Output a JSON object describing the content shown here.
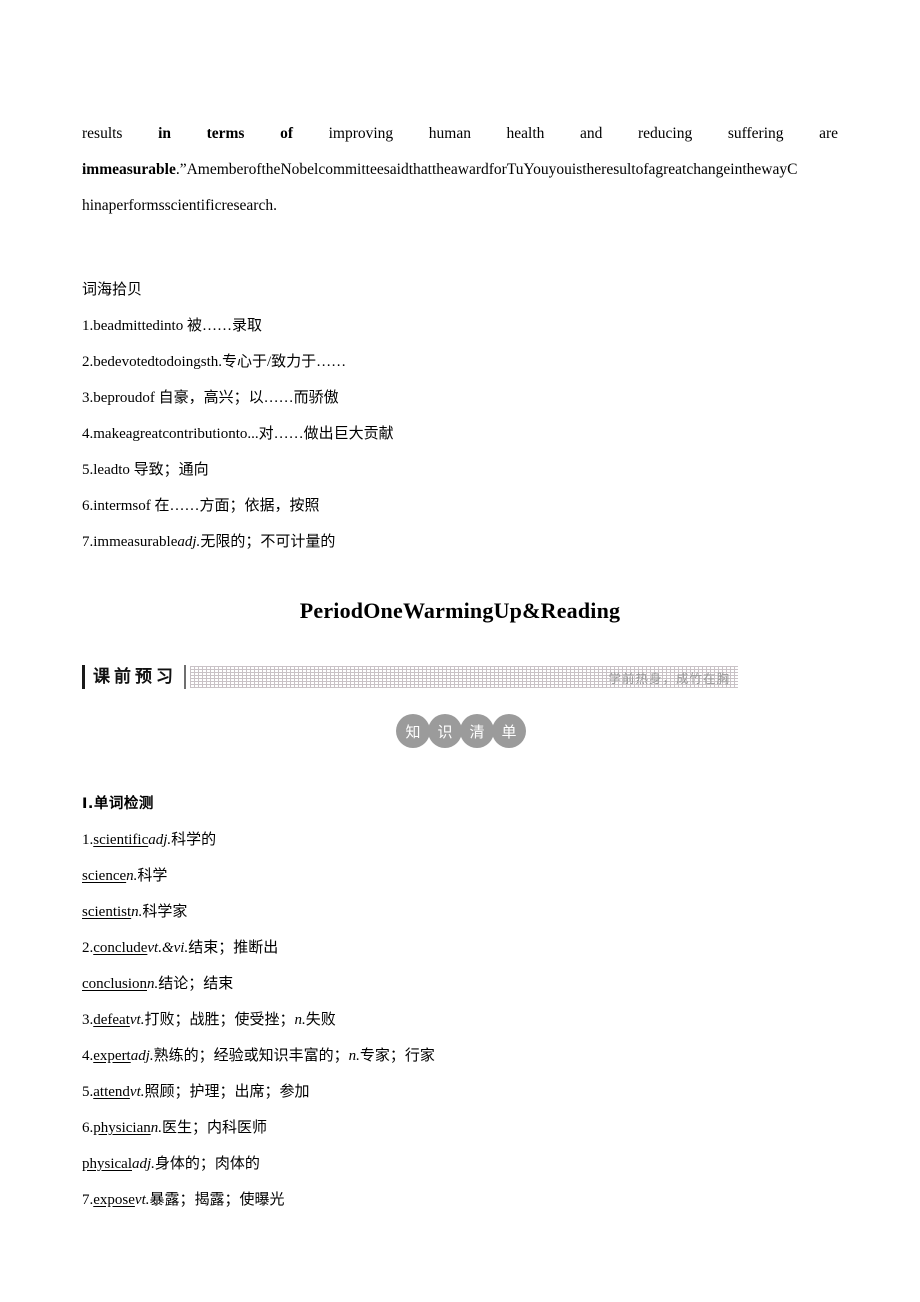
{
  "paragraph": {
    "line1_words": [
      "results",
      "in",
      "terms",
      "of",
      "improving",
      "human",
      "health",
      "and",
      "reducing",
      "suffering",
      "are"
    ],
    "line1_bold": [
      "in",
      "terms",
      "of"
    ],
    "line2_bold": "immeasurable",
    "line2_rest": ".”AmemberoftheNobelcommitteesaidthattheawardforTuYouyouistheresultofagreatchangeinthewayC",
    "line3": "hinaperformsscientificresearch."
  },
  "cihai": {
    "title": "词海拾贝",
    "items": [
      {
        "num": "1.",
        "word": "beadmittedinto",
        "pos": "",
        "gloss": " 被……录取"
      },
      {
        "num": "2.",
        "word": "bedevotedtodoingsth.",
        "pos": "",
        "gloss": "专心于/致力于……"
      },
      {
        "num": "3.",
        "word": "beproudof",
        "pos": "",
        "gloss": " 自豪，高兴；以……而骄傲"
      },
      {
        "num": "4.",
        "word": "makeagreatcontributionto...",
        "pos": "",
        "gloss": "对……做出巨大贡献"
      },
      {
        "num": "5.",
        "word": "leadto",
        "pos": "",
        "gloss": " 导致；通向"
      },
      {
        "num": "6.",
        "word": "intermsof",
        "pos": "",
        "gloss": " 在……方面；依据，按照"
      },
      {
        "num": "7.",
        "word": "immeasurable",
        "pos": "adj.",
        "gloss": "无限的；不可计量的"
      }
    ]
  },
  "period_title": "PeriodOneWarmingUp&Reading",
  "banner": {
    "label": "课前预习",
    "motto": "学前热身，成竹在胸"
  },
  "badge": {
    "chars": [
      "知",
      "识",
      "清",
      "单"
    ]
  },
  "words_section": {
    "heading": "Ⅰ.单词检测",
    "entries": [
      {
        "num": "1.",
        "word": "scientific",
        "pos": "adj.",
        "gloss": "科学的"
      },
      {
        "num": "",
        "word": "science",
        "pos": "n.",
        "gloss": "科学"
      },
      {
        "num": "",
        "word": "scientist",
        "pos": "n.",
        "gloss": "科学家"
      },
      {
        "num": "2.",
        "word": "conclude",
        "pos": "vt.&vi.",
        "gloss": "结束；推断出"
      },
      {
        "num": "",
        "word": "conclusion",
        "pos": "n.",
        "gloss": "结论；结束"
      },
      {
        "num": "3.",
        "word": "defeat",
        "pos": "vt.",
        "gloss": "打败；战胜；使受挫；",
        "pos2": "n.",
        "gloss2": "失败"
      },
      {
        "num": "4.",
        "word": "expert",
        "pos": "adj.",
        "gloss": "熟练的；经验或知识丰富的；",
        "pos2": "n.",
        "gloss2": "专家；行家"
      },
      {
        "num": "5.",
        "word": "attend",
        "pos": "vt.",
        "gloss": "照顾；护理；出席；参加"
      },
      {
        "num": "6.",
        "word": "physician",
        "pos": "n.",
        "gloss": "医生；内科医师"
      },
      {
        "num": "",
        "word": "physical",
        "pos": "adj.",
        "gloss": "身体的；肉体的"
      },
      {
        "num": "7.",
        "word": "expose",
        "pos": "vt.",
        "gloss": "暴露；揭露；使曝光"
      }
    ]
  }
}
